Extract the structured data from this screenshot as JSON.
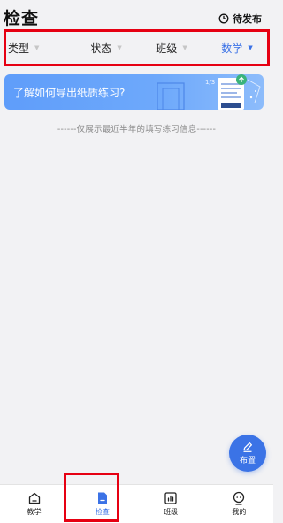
{
  "header": {
    "title": "检查",
    "pending_label": "待发布",
    "pending_icon": "clock-icon"
  },
  "filters": [
    {
      "label": "类型",
      "icon": "caret-down-icon",
      "active": false
    },
    {
      "label": "状态",
      "icon": "caret-down-icon",
      "active": false
    },
    {
      "label": "班级",
      "icon": "caret-down-icon",
      "active": false
    },
    {
      "label": "数学",
      "icon": "caret-down-icon",
      "active": true
    }
  ],
  "banner": {
    "text": "了解如何导出纸质练习?",
    "art_label": "1/3"
  },
  "notice": "------仅展示最近半年的填写练习信息------",
  "fab": {
    "label": "布置",
    "icon": "pen-icon"
  },
  "tabbar": [
    {
      "label": "教学",
      "icon": "home-icon",
      "active": false
    },
    {
      "label": "检查",
      "icon": "doc-icon",
      "active": true
    },
    {
      "label": "班级",
      "icon": "chart-icon",
      "active": false
    },
    {
      "label": "我的",
      "icon": "user-icon",
      "active": false
    }
  ],
  "colors": {
    "accent": "#3b72e6",
    "highlight": "#e60012",
    "background": "#f2f2f4",
    "banner": "#6ea9fb"
  }
}
